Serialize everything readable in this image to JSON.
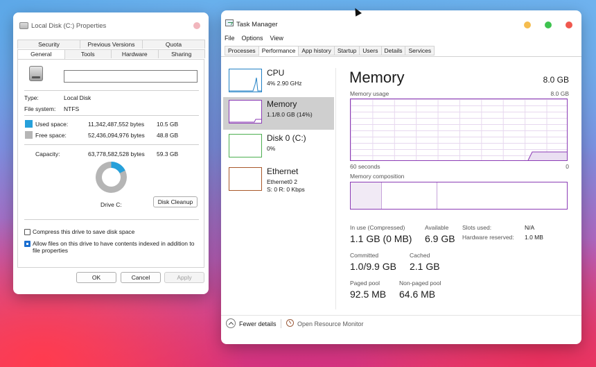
{
  "properties": {
    "title": "Local Disk (C:) Properties",
    "tabs_top": [
      "Security",
      "Previous Versions",
      "Quota"
    ],
    "tabs_bottom": [
      "General",
      "Tools",
      "Hardware",
      "Sharing"
    ],
    "active_tab": "General",
    "name_value": "",
    "type_label": "Type:",
    "type_value": "Local Disk",
    "fs_label": "File system:",
    "fs_value": "NTFS",
    "used": {
      "label": "Used space:",
      "bytes": "11,342,487,552 bytes",
      "gb": "10.5 GB",
      "color": "#26a0da"
    },
    "free": {
      "label": "Free space:",
      "bytes": "52,436,094,976 bytes",
      "gb": "48.8 GB",
      "color": "#b5b5b5"
    },
    "capacity": {
      "label": "Capacity:",
      "bytes": "63,778,582,528 bytes",
      "gb": "59.3 GB"
    },
    "drive_caption": "Drive C:",
    "disk_cleanup": "Disk Cleanup",
    "compress_label": "Compress this drive to save disk space",
    "compress_checked": false,
    "index_label_1": "Allow files on this drive to have contents indexed in addition to",
    "index_label_2": "file properties",
    "index_checked": true,
    "ok": "OK",
    "cancel": "Cancel",
    "apply": "Apply"
  },
  "taskmanager": {
    "title": "Task Manager",
    "menu": [
      "File",
      "Options",
      "View"
    ],
    "tabs": [
      "Processes",
      "Performance",
      "App history",
      "Startup",
      "Users",
      "Details",
      "Services"
    ],
    "active_tab": "Performance",
    "sidebar": [
      {
        "name": "CPU",
        "sub1": "4% 2.90 GHz",
        "sub2": "",
        "color": "#1f7fc4"
      },
      {
        "name": "Memory",
        "sub1": "1.1/8.0 GB (14%)",
        "sub2": "",
        "color": "#8b3bb5"
      },
      {
        "name": "Disk 0 (C:)",
        "sub1": "0%",
        "sub2": "",
        "color": "#4caf50"
      },
      {
        "name": "Ethernet",
        "sub1": "Ethernet0 2",
        "sub2": "S: 0 R: 0 Kbps",
        "color": "#a9582a"
      }
    ],
    "selected_sidebar": "Memory",
    "memory_title": "Memory",
    "memory_total": "8.0 GB",
    "usage_label": "Memory usage",
    "usage_max": "8.0 GB",
    "time_left": "60 seconds",
    "time_right": "0",
    "composition_label": "Memory composition",
    "stats": {
      "in_use_label": "In use (Compressed)",
      "in_use_value": "1.1 GB (0 MB)",
      "available_label": "Available",
      "available_value": "6.9 GB",
      "committed_label": "Committed",
      "committed_value": "1.0/9.9 GB",
      "cached_label": "Cached",
      "cached_value": "2.1 GB",
      "paged_label": "Paged pool",
      "paged_value": "92.5 MB",
      "nonpaged_label": "Non-paged pool",
      "nonpaged_value": "64.6 MB",
      "slots_label": "Slots used:",
      "slots_value": "N/A",
      "hw_reserved_label": "Hardware reserved:",
      "hw_reserved_value": "1.0 MB"
    },
    "fewer_details": "Fewer details",
    "open_resource_monitor": "Open Resource Monitor",
    "traffic_colors": {
      "minimize": "#f5bd4f",
      "maximize": "#3ec34f",
      "close": "#f0584e"
    },
    "accent": "#8b3bb5"
  }
}
